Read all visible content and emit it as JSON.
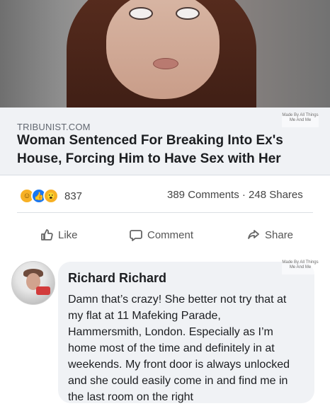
{
  "post": {
    "image_alt": "woman-photo",
    "watermark_top": "Made By All Things Me And Me",
    "domain": "TRIBUNIST.COM",
    "headline": "Woman Sentenced For Breaking Into Ex's House, Forcing Him to Have Sex with Her",
    "reactions": {
      "icons": [
        "laugh-reaction-icon",
        "like-reaction-icon",
        "wow-reaction-icon"
      ],
      "count": "837"
    },
    "stats": "389 Comments · 248 Shares",
    "actions": {
      "like": "Like",
      "comment": "Comment",
      "share": "Share"
    }
  },
  "comment": {
    "author": "Richard Richard",
    "watermark": "Made By All Things Me And Me",
    "text": "Damn that’s crazy! She better not try that at\nmy flat at 11 Mafeking Parade,\nHammersmith, London. Especially as I’m\nhome most of the time and definitely in at\nweekends. My front door is always unlocked\nand she could easily come in and find me in\nthe last room on the right"
  },
  "colors": {
    "link_background": "#f0f2f5",
    "comment_background": "#f0f2f5",
    "facebook_blue": "#1877f2",
    "reaction_yellow": "#f7b125"
  }
}
